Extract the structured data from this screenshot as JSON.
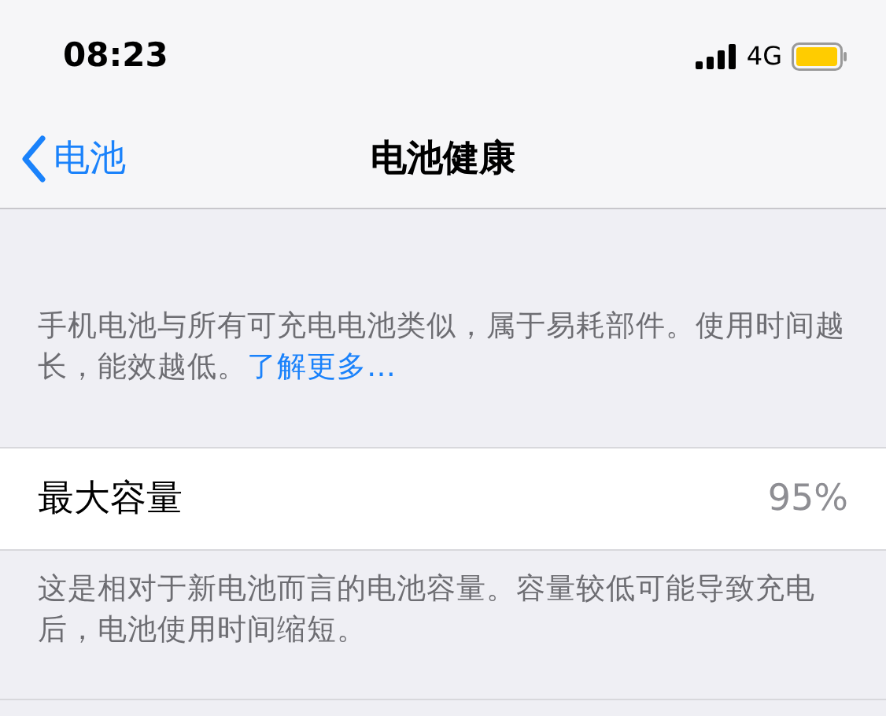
{
  "status_bar": {
    "time": "08:23",
    "network": "4G"
  },
  "nav": {
    "back": "电池",
    "title": "电池健康"
  },
  "intro": {
    "text": "手机电池与所有可充电电池类似，属于易耗部件。使用时间越长，能效越低。",
    "link": "了解更多…"
  },
  "rows": [
    {
      "label": "最大容量",
      "value": "95%",
      "footer": "这是相对于新电池而言的电池容量。容量较低可能导致充电后，电池使用时间缩短。"
    }
  ]
}
